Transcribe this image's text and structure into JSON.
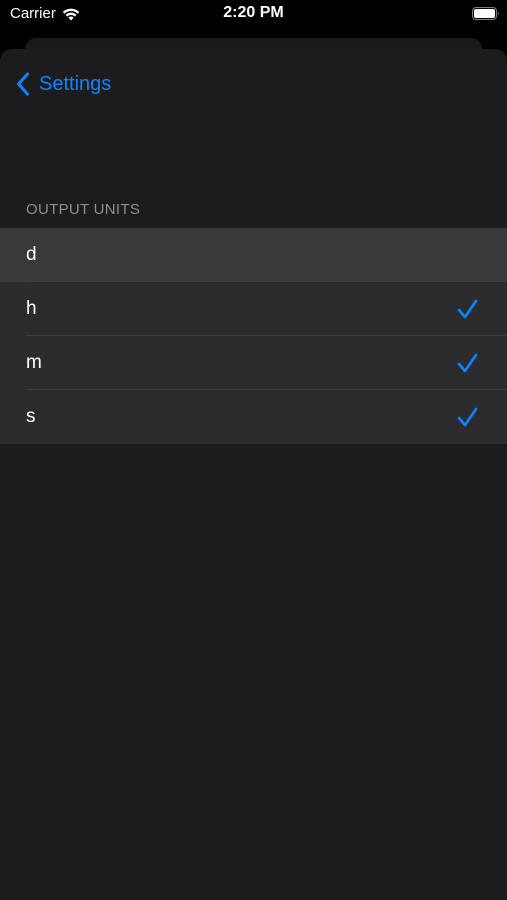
{
  "status_bar": {
    "carrier": "Carrier",
    "time": "2:20 PM",
    "wifi_icon": "wifi-icon",
    "battery_icon": "battery-icon"
  },
  "nav": {
    "back_label": "Settings",
    "back_icon": "chevron-left-icon"
  },
  "section": {
    "header": "OUTPUT UNITS"
  },
  "units": [
    {
      "label": "d",
      "checked": false,
      "highlighted": true
    },
    {
      "label": "h",
      "checked": true,
      "highlighted": false
    },
    {
      "label": "m",
      "checked": true,
      "highlighted": false
    },
    {
      "label": "s",
      "checked": true,
      "highlighted": false
    }
  ],
  "colors": {
    "accent": "#0a84ff",
    "background": "#1c1c1e",
    "cell": "#2c2c2e",
    "cell_highlight": "#39393c",
    "secondary_text": "#8e8e93"
  }
}
